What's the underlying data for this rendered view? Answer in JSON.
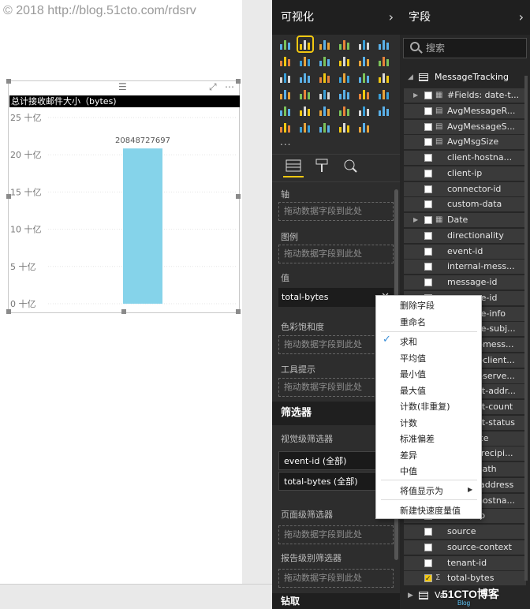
{
  "watermark": {
    "top": "© 2018 http://blog.51cto.com/rdsrv",
    "bottom": "51CTO博客",
    "bottom_sub": "Blog"
  },
  "chart": {
    "title": "总计接收邮件大小（bytes)",
    "data_label": "20848727697"
  },
  "chart_data": {
    "type": "bar",
    "title": "总计接收邮件大小（bytes)",
    "categories": [
      ""
    ],
    "values": [
      20848727697
    ],
    "ylim": [
      0,
      25000000000
    ],
    "yticks": [
      {
        "value": 0,
        "label": "0 十亿"
      },
      {
        "value": 5000000000,
        "label": "5 十亿"
      },
      {
        "value": 10000000000,
        "label": "10 十亿"
      },
      {
        "value": 15000000000,
        "label": "15 十亿"
      },
      {
        "value": 20000000000,
        "label": "20 十亿"
      },
      {
        "value": 25000000000,
        "label": "25 十亿"
      }
    ],
    "data_labels": [
      "20848727697"
    ],
    "grid": true,
    "bar_color": "#85d3ea"
  },
  "visualizations": {
    "title": "可视化",
    "more": "...",
    "wells": {
      "axis_label": "轴",
      "legend_label": "图例",
      "value_label": "值",
      "saturation_label": "色彩饱和度",
      "tooltip_label": "工具提示",
      "drop_placeholder": "拖动数据字段到此处",
      "value_field": "total-bytes"
    },
    "filters": {
      "title": "筛选器",
      "visual_level": "视觉级筛选器",
      "visual_filters": [
        "event-id (全部)",
        "total-bytes (全部)"
      ],
      "page_level": "页面级筛选器",
      "report_level": "报告级别筛选器"
    },
    "drillthrough": "钻取"
  },
  "fields": {
    "title": "字段",
    "search_placeholder": "搜索",
    "table": "MessageTracking",
    "rows": [
      {
        "name": "#Fields: date-t...",
        "checked": false,
        "expandable": true,
        "icon": "table"
      },
      {
        "name": "AvgMessageR...",
        "checked": false,
        "expandable": false,
        "icon": "calculator"
      },
      {
        "name": "AvgMessageS...",
        "checked": false,
        "expandable": false,
        "icon": "calculator"
      },
      {
        "name": "AvgMsgSize",
        "checked": false,
        "expandable": false,
        "icon": "calculator"
      },
      {
        "name": "client-hostna...",
        "checked": false,
        "expandable": false,
        "icon": ""
      },
      {
        "name": "client-ip",
        "checked": false,
        "expandable": false,
        "icon": ""
      },
      {
        "name": "connector-id",
        "checked": false,
        "expandable": false,
        "icon": ""
      },
      {
        "name": "custom-data",
        "checked": false,
        "expandable": false,
        "icon": ""
      },
      {
        "name": "Date",
        "checked": false,
        "expandable": true,
        "icon": "table"
      },
      {
        "name": "directionality",
        "checked": false,
        "expandable": false,
        "icon": ""
      },
      {
        "name": "event-id",
        "checked": false,
        "expandable": false,
        "icon": ""
      },
      {
        "name": "internal-mess...",
        "checked": false,
        "expandable": false,
        "icon": ""
      },
      {
        "name": "message-id",
        "checked": false,
        "expandable": false,
        "icon": ""
      },
      {
        "name": "message-id",
        "checked": false,
        "expandable": true,
        "icon": ""
      },
      {
        "name": "message-info",
        "checked": false,
        "expandable": false,
        "icon": ""
      },
      {
        "name": "message-subj...",
        "checked": false,
        "expandable": false,
        "icon": ""
      },
      {
        "name": "original-mess...",
        "checked": false,
        "expandable": false,
        "icon": ""
      },
      {
        "name": "original-client...",
        "checked": false,
        "expandable": false,
        "icon": ""
      },
      {
        "name": "original-serve...",
        "checked": false,
        "expandable": false,
        "icon": ""
      },
      {
        "name": "recipient-addr...",
        "checked": false,
        "expandable": false,
        "icon": ""
      },
      {
        "name": "recipient-count",
        "checked": false,
        "expandable": false,
        "icon": ""
      },
      {
        "name": "recipient-status",
        "checked": false,
        "expandable": false,
        "icon": ""
      },
      {
        "name": "reference",
        "checked": false,
        "expandable": false,
        "icon": ""
      },
      {
        "name": "related-recipi...",
        "checked": false,
        "expandable": false,
        "icon": ""
      },
      {
        "name": "return-path",
        "checked": false,
        "expandable": false,
        "icon": ""
      },
      {
        "name": "sender-address",
        "checked": false,
        "expandable": false,
        "icon": ""
      },
      {
        "name": "server-hostna...",
        "checked": false,
        "expandable": false,
        "icon": ""
      },
      {
        "name": "server-ip",
        "checked": false,
        "expandable": false,
        "icon": ""
      },
      {
        "name": "source",
        "checked": false,
        "expandable": false,
        "icon": ""
      },
      {
        "name": "source-context",
        "checked": false,
        "expandable": false,
        "icon": ""
      },
      {
        "name": "tenant-id",
        "checked": false,
        "expandable": false,
        "icon": ""
      },
      {
        "name": "total-bytes",
        "checked": true,
        "expandable": false,
        "icon": "sigma"
      }
    ],
    "next_table": "Va..."
  },
  "context_menu": {
    "items": [
      {
        "label": "删除字段",
        "checked": false,
        "submenu": false
      },
      {
        "label": "重命名",
        "checked": false,
        "submenu": false
      },
      {
        "label": "求和",
        "checked": true,
        "submenu": false
      },
      {
        "label": "平均值",
        "checked": false,
        "submenu": false
      },
      {
        "label": "最小值",
        "checked": false,
        "submenu": false
      },
      {
        "label": "最大值",
        "checked": false,
        "submenu": false
      },
      {
        "label": "计数(非重复)",
        "checked": false,
        "submenu": false
      },
      {
        "label": "计数",
        "checked": false,
        "submenu": false
      },
      {
        "label": "标准偏差",
        "checked": false,
        "submenu": false
      },
      {
        "label": "差异",
        "checked": false,
        "submenu": false
      },
      {
        "label": "中值",
        "checked": false,
        "submenu": false
      },
      {
        "label": "将值显示为",
        "checked": false,
        "submenu": true
      },
      {
        "label": "新建快速度量值",
        "checked": false,
        "submenu": false
      }
    ]
  },
  "colors": {
    "accent": "#f2c811",
    "bar": "#85d3ea",
    "pane_bg": "#2d2d2d",
    "fields_bg": "#262626"
  },
  "vis_icons": [
    "stacked-bar",
    "stacked-column",
    "clustered-bar",
    "clustered-column",
    "100-bar",
    "100-column",
    "line",
    "area",
    "stacked-area",
    "line-column",
    "line-stacked",
    "ribbon",
    "waterfall",
    "scatter",
    "pie",
    "donut",
    "treemap",
    "map",
    "filled-map",
    "funnel",
    "gauge",
    "multirow-card",
    "card",
    "kpi",
    "slicer",
    "table",
    "matrix",
    "r-script",
    "globe",
    "shape-map",
    "arcgis",
    "gear",
    "arrows",
    "power-apps",
    "line-chart-dark"
  ]
}
